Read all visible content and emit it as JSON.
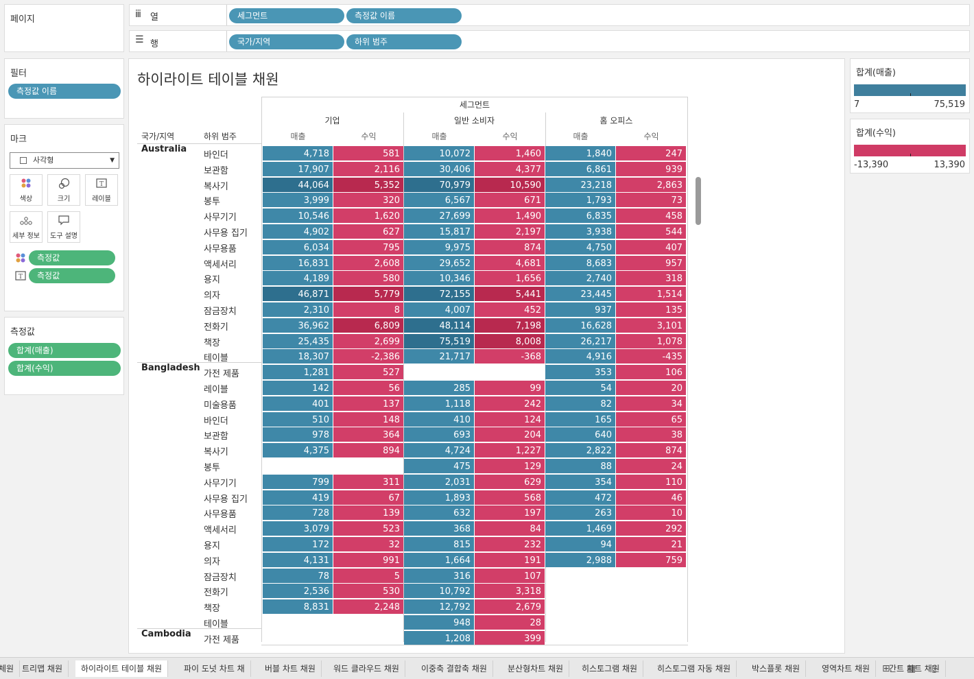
{
  "shelves": {
    "pages_label": "페이지",
    "columns_label": "열",
    "rows_label": "행",
    "columns": [
      "세그먼트",
      "측정값 이름"
    ],
    "rows": [
      "국가/지역",
      "하위 범주"
    ]
  },
  "filters": {
    "title": "필터",
    "items": [
      "측정값 이름"
    ]
  },
  "marks": {
    "title": "마크",
    "type": "사각형",
    "buttons": [
      {
        "label": "색상",
        "icon": "color-icon"
      },
      {
        "label": "크기",
        "icon": "size-icon"
      },
      {
        "label": "레이블",
        "icon": "label-icon"
      },
      {
        "label": "세부 정보",
        "icon": "detail-icon"
      },
      {
        "label": "도구 설명",
        "icon": "tooltip-icon"
      }
    ],
    "fields": [
      {
        "label": "측정값",
        "icon": "color-icon"
      },
      {
        "label": "측정값",
        "icon": "label-icon"
      }
    ]
  },
  "measure_values": {
    "title": "측정값",
    "items": [
      "합계(매출)",
      "합계(수익)"
    ]
  },
  "view": {
    "title": "하이라이트 테이블 채원",
    "segment_header": "세그먼트",
    "segments": [
      "기업",
      "일반 소비자",
      "홈 오피스"
    ],
    "measures": [
      "매출",
      "수익"
    ],
    "row_headers": [
      "국가/지역",
      "하위 범주"
    ]
  },
  "legends": {
    "sales": {
      "title": "합계(매출)",
      "min": "7",
      "max": "75,519",
      "color": "#3f7f9d"
    },
    "profit": {
      "title": "합계(수익)",
      "min": "-13,390",
      "max": "13,390",
      "color": "#cf3b65"
    }
  },
  "colors": {
    "sales": "#3f88a8",
    "sales_dark": "#2e6f8e",
    "profit": "#d23e68",
    "profit_dark": "#b8294f",
    "pill_blue": "#4a96b5",
    "pill_green": "#4db57a"
  },
  "table": {
    "groups": [
      {
        "country": "Australia",
        "rows": [
          {
            "sub": "바인더",
            "v": [
              "4,718",
              "581",
              "10,072",
              "1,460",
              "1,840",
              "247"
            ]
          },
          {
            "sub": "보관함",
            "v": [
              "17,907",
              "2,116",
              "30,406",
              "4,377",
              "6,861",
              "939"
            ]
          },
          {
            "sub": "복사기",
            "v": [
              "44,064",
              "5,352",
              "70,979",
              "10,590",
              "23,218",
              "2,863"
            ]
          },
          {
            "sub": "봉투",
            "v": [
              "3,999",
              "320",
              "6,567",
              "671",
              "1,793",
              "73"
            ]
          },
          {
            "sub": "사무기기",
            "v": [
              "10,546",
              "1,620",
              "27,699",
              "1,490",
              "6,835",
              "458"
            ]
          },
          {
            "sub": "사무용 집기",
            "v": [
              "4,902",
              "627",
              "15,817",
              "2,197",
              "3,938",
              "544"
            ]
          },
          {
            "sub": "사무용품",
            "v": [
              "6,034",
              "795",
              "9,975",
              "874",
              "4,750",
              "407"
            ]
          },
          {
            "sub": "액세서리",
            "v": [
              "16,831",
              "2,608",
              "29,652",
              "4,681",
              "8,683",
              "957"
            ]
          },
          {
            "sub": "용지",
            "v": [
              "4,189",
              "580",
              "10,346",
              "1,656",
              "2,740",
              "318"
            ]
          },
          {
            "sub": "의자",
            "v": [
              "46,871",
              "5,779",
              "72,155",
              "5,441",
              "23,445",
              "1,514"
            ]
          },
          {
            "sub": "잠금장치",
            "v": [
              "2,310",
              "8",
              "4,007",
              "452",
              "937",
              "135"
            ]
          },
          {
            "sub": "전화기",
            "v": [
              "36,962",
              "6,809",
              "48,114",
              "7,198",
              "16,628",
              "3,101"
            ]
          },
          {
            "sub": "책장",
            "v": [
              "25,435",
              "2,699",
              "75,519",
              "8,008",
              "26,217",
              "1,078"
            ]
          },
          {
            "sub": "테이블",
            "v": [
              "18,307",
              "-2,386",
              "21,717",
              "-368",
              "4,916",
              "-435"
            ]
          }
        ]
      },
      {
        "country": "Bangladesh",
        "rows": [
          {
            "sub": "가전 제품",
            "v": [
              "1,281",
              "527",
              "",
              "",
              "353",
              "106"
            ]
          },
          {
            "sub": "레이블",
            "v": [
              "142",
              "56",
              "285",
              "99",
              "54",
              "20"
            ]
          },
          {
            "sub": "미술용품",
            "v": [
              "401",
              "137",
              "1,118",
              "242",
              "82",
              "34"
            ]
          },
          {
            "sub": "바인더",
            "v": [
              "510",
              "148",
              "410",
              "124",
              "165",
              "65"
            ]
          },
          {
            "sub": "보관함",
            "v": [
              "978",
              "364",
              "693",
              "204",
              "640",
              "38"
            ]
          },
          {
            "sub": "복사기",
            "v": [
              "4,375",
              "894",
              "4,724",
              "1,227",
              "2,822",
              "874"
            ]
          },
          {
            "sub": "봉투",
            "v": [
              "",
              "",
              "475",
              "129",
              "88",
              "24"
            ]
          },
          {
            "sub": "사무기기",
            "v": [
              "799",
              "311",
              "2,031",
              "629",
              "354",
              "110"
            ]
          },
          {
            "sub": "사무용 집기",
            "v": [
              "419",
              "67",
              "1,893",
              "568",
              "472",
              "46"
            ]
          },
          {
            "sub": "사무용품",
            "v": [
              "728",
              "139",
              "632",
              "197",
              "263",
              "10"
            ]
          },
          {
            "sub": "액세서리",
            "v": [
              "3,079",
              "523",
              "368",
              "84",
              "1,469",
              "292"
            ]
          },
          {
            "sub": "용지",
            "v": [
              "172",
              "32",
              "815",
              "232",
              "94",
              "21"
            ]
          },
          {
            "sub": "의자",
            "v": [
              "4,131",
              "991",
              "1,664",
              "191",
              "2,988",
              "759"
            ]
          },
          {
            "sub": "잠금장치",
            "v": [
              "78",
              "5",
              "316",
              "107",
              "",
              ""
            ]
          },
          {
            "sub": "전화기",
            "v": [
              "2,536",
              "530",
              "10,792",
              "3,318",
              "",
              ""
            ]
          },
          {
            "sub": "책장",
            "v": [
              "8,831",
              "2,248",
              "12,792",
              "2,679",
              "",
              ""
            ]
          },
          {
            "sub": "테이블",
            "v": [
              "",
              "",
              "948",
              "28",
              "",
              ""
            ]
          }
        ]
      },
      {
        "country": "Cambodia",
        "rows": [
          {
            "sub": "가전 제품",
            "v": [
              "",
              "",
              "1,208",
              "399",
              "",
              ""
            ]
          }
        ]
      }
    ]
  },
  "tabs": {
    "items": [
      "체원",
      "트리맵 채원",
      "하이라이트 테이블 채원",
      "파이 도넛 차트 채",
      "버블 차트 채원",
      "워드 클라우드 채원",
      "이중축 결합축 채원",
      "분산형차트 채원",
      "히스토그램 채원",
      "히스토그램 자동 채원",
      "박스플롯 채원",
      "영역차트 채원",
      "간트 차트 채원"
    ],
    "active_index": 2,
    "icons": [
      "new-worksheet-icon",
      "new-dashboard-icon",
      "new-story-icon"
    ]
  }
}
